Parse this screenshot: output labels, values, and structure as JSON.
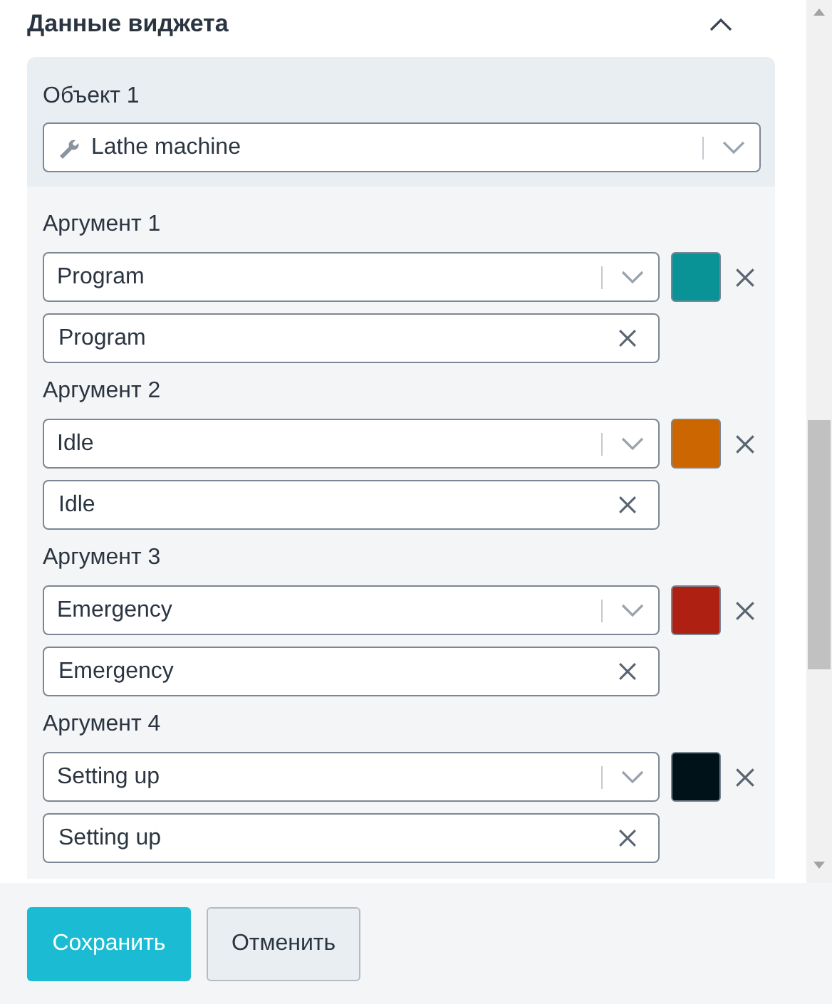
{
  "section": {
    "title": "Данные виджета",
    "expanded": true
  },
  "object": {
    "label": "Объект 1",
    "value": "Lathe machine"
  },
  "arguments": [
    {
      "label": "Аргумент 1",
      "value": "Program",
      "name": "Program",
      "color": "#0a9396"
    },
    {
      "label": "Аргумент 2",
      "value": "Idle",
      "name": "Idle",
      "color": "#cc6600"
    },
    {
      "label": "Аргумент 3",
      "value": "Emergency",
      "name": "Emergency",
      "color": "#ae2012"
    },
    {
      "label": "Аргумент 4",
      "value": "Setting up",
      "name": "Setting up",
      "color": "#001219"
    }
  ],
  "buttons": [
    {
      "label": "Сохранить",
      "kind": "primary"
    },
    {
      "label": "Отменить",
      "kind": "secondary"
    }
  ]
}
